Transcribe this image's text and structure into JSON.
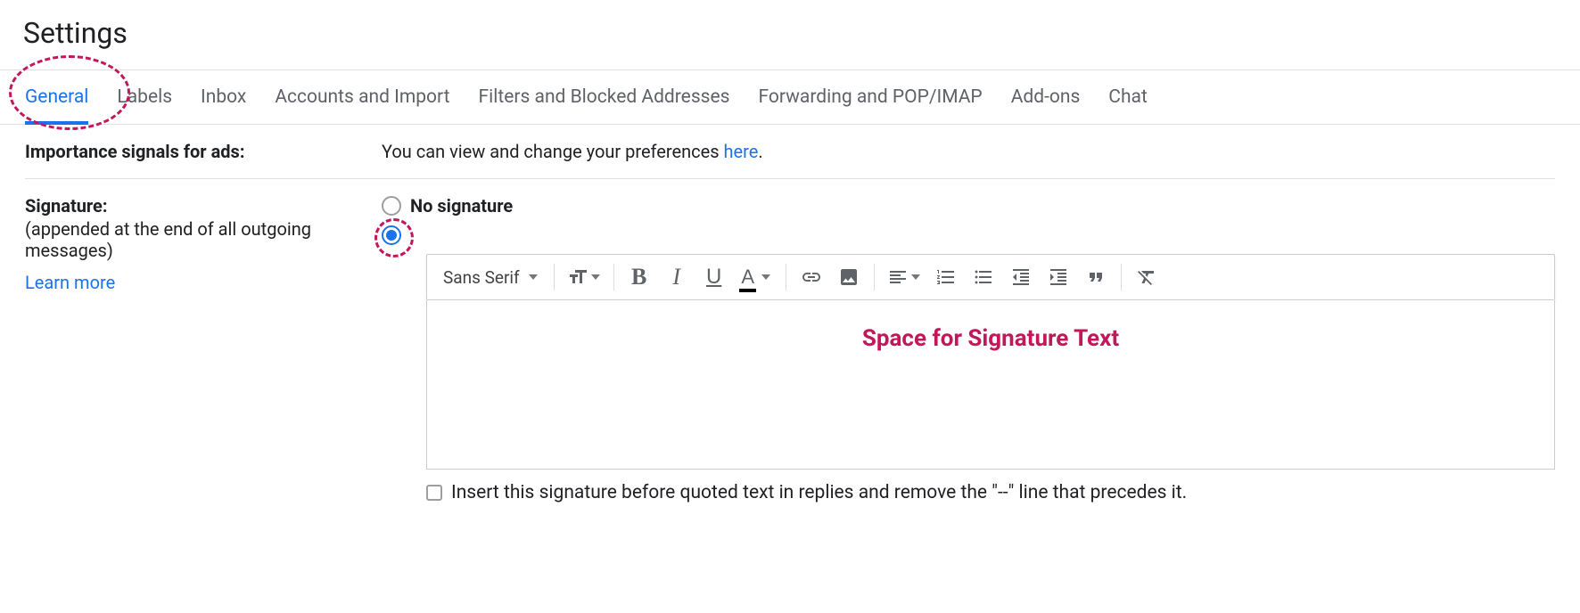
{
  "title": "Settings",
  "tabs": [
    {
      "label": "General",
      "active": true
    },
    {
      "label": "Labels",
      "active": false
    },
    {
      "label": "Inbox",
      "active": false
    },
    {
      "label": "Accounts and Import",
      "active": false
    },
    {
      "label": "Filters and Blocked Addresses",
      "active": false
    },
    {
      "label": "Forwarding and POP/IMAP",
      "active": false
    },
    {
      "label": "Add-ons",
      "active": false
    },
    {
      "label": "Chat",
      "active": false
    }
  ],
  "importance": {
    "label": "Importance signals for ads:",
    "text_before": "You can view and change your preferences ",
    "link": "here",
    "text_after": "."
  },
  "signature": {
    "label": "Signature:",
    "sub": "(appended at the end of all outgoing messages)",
    "learn": "Learn more",
    "no_sig_label": "No signature",
    "font_selector": "Sans Serif",
    "editor_placeholder": "Space for Signature Text",
    "checkbox_label": "Insert this signature before quoted text in replies and remove the \"--\" line that precedes it."
  }
}
